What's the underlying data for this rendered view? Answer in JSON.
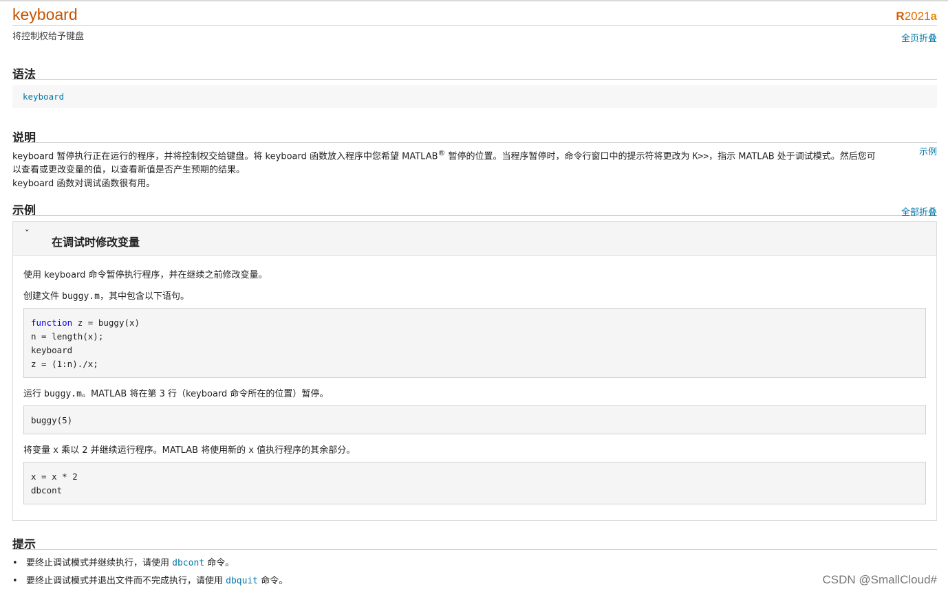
{
  "header": {
    "title": "keyboard",
    "release_r": "R",
    "release_year": "2021",
    "release_a": "a",
    "purpose": "将控制权给予键盘",
    "collapse_page": "全页折叠"
  },
  "syntax": {
    "heading": "语法",
    "code": "keyboard"
  },
  "description": {
    "heading": "说明",
    "p1_a": "keyboard 暂停执行正在运行的程序，并将控制权交给键盘。将 keyboard 函数放入程序中您希望 MATLAB",
    "p1_reg": "®",
    "p1_b": " 暂停的位置。当程序暂停时，命令行窗口中的提示符将更改为 ",
    "p1_prompt": "K>>",
    "p1_c": "，指示 MATLAB 处于调试模式。然后您可以查看或更改变量的值，以查看新值是否产生预期的结果。",
    "p2": "keyboard 函数对调试函数很有用。",
    "example_link": "示例"
  },
  "examples": {
    "heading": "示例",
    "collapse_all": "全部折叠",
    "card": {
      "title": "在调试时修改变量",
      "chevron": "ˇ",
      "p1": "使用 keyboard 命令暂停执行程序，并在继续之前修改变量。",
      "p2_a": "创建文件 ",
      "p2_file": "buggy.m",
      "p2_b": "，其中包含以下语句。",
      "code1_kw": "function",
      "code1_rest": " z = buggy(x)\nn = length(x);\nkeyboard\nz = (1:n)./x;",
      "p3_a": "运行 ",
      "p3_file": "buggy.m",
      "p3_b": "。MATLAB 将在第 3 行（keyboard 命令所在的位置）暂停。",
      "code2": "buggy(5)",
      "p4_a": "将变量 ",
      "p4_var1": "x",
      "p4_b": " 乘以 2 并继续运行程序。MATLAB 将使用新的 ",
      "p4_var2": "x",
      "p4_c": " 值执行程序的其余部分。",
      "code3": "x = x * 2\ndbcont"
    }
  },
  "tips": {
    "heading": "提示",
    "items": [
      {
        "bullet": "•",
        "a": "要终止调试模式并继续执行，请使用 ",
        "link": "dbcont",
        "b": " 命令。"
      },
      {
        "bullet": "•",
        "a": "要终止调试模式并退出文件而不完成执行，请使用 ",
        "link": "dbquit",
        "b": " 命令。"
      }
    ]
  },
  "watermark": "CSDN @SmallCloud#"
}
